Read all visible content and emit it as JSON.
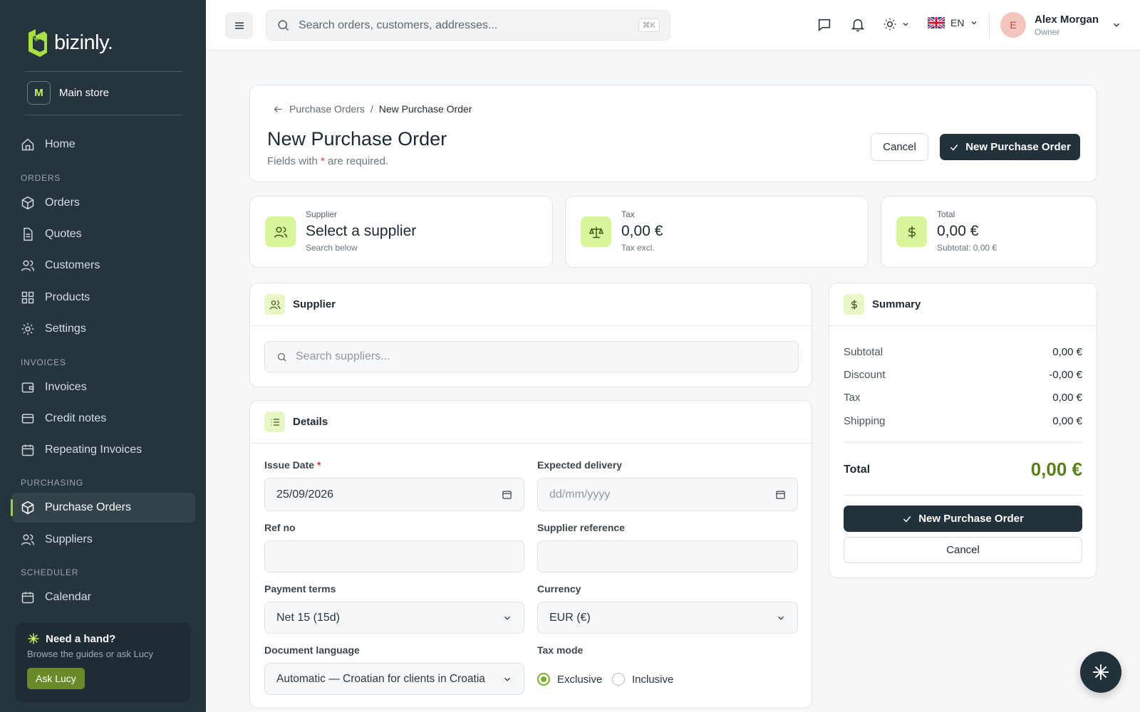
{
  "app": {
    "name": "bizinly."
  },
  "store": {
    "badge": "M",
    "name": "Main store"
  },
  "sidebar": {
    "home": "Home",
    "sections": {
      "orders": "ORDERS",
      "invoices": "INVOICES",
      "purchasing": "PURCHASING",
      "scheduler": "SCHEDULER"
    },
    "items": {
      "orders": "Orders",
      "quotes": "Quotes",
      "customers": "Customers",
      "products": "Products",
      "settings": "Settings",
      "invoices": "Invoices",
      "credit_notes": "Credit notes",
      "repeating_invoices": "Repeating Invoices",
      "purchase_orders": "Purchase Orders",
      "suppliers": "Suppliers",
      "calendar": "Calendar"
    },
    "help": {
      "title": "Need a hand?",
      "subtitle": "Browse the guides or ask Lucy",
      "button": "Ask Lucy"
    }
  },
  "topbar": {
    "search_placeholder": "Search orders, customers, addresses...",
    "shortcut": "⌘K",
    "language": "EN",
    "user": {
      "initial": "E",
      "name": "Alex Morgan",
      "role": "Owner"
    }
  },
  "page": {
    "breadcrumb": {
      "parent": "Purchase Orders",
      "separator": "/",
      "current": "New Purchase Order"
    },
    "title": "New Purchase Order",
    "required_note": {
      "prefix": "Fields with",
      "star": "*",
      "suffix": "are required."
    },
    "cancel": "Cancel",
    "submit": "New Purchase Order"
  },
  "stats": {
    "supplier": {
      "label": "Supplier",
      "value": "Select a supplier",
      "sub": "Search below"
    },
    "tax": {
      "label": "Tax",
      "value": "0,00 €",
      "sub": "Tax excl."
    },
    "total": {
      "label": "Total",
      "value": "0,00 €",
      "sub": "Subtotal: 0,00 €"
    }
  },
  "supplier_section": {
    "title": "Supplier",
    "search_placeholder": "Search suppliers..."
  },
  "details": {
    "title": "Details",
    "issue_date": {
      "label": "Issue Date",
      "star": "*",
      "value": "25/09/2026"
    },
    "expected_delivery": {
      "label": "Expected delivery",
      "placeholder": "dd/mm/yyyy"
    },
    "ref_no": {
      "label": "Ref no",
      "value": ""
    },
    "supplier_reference": {
      "label": "Supplier reference",
      "value": ""
    },
    "payment_terms": {
      "label": "Payment terms",
      "value": "Net 15 (15d)"
    },
    "currency": {
      "label": "Currency",
      "value": "EUR (€)"
    },
    "document_language": {
      "label": "Document language",
      "value": "Automatic — Croatian for clients in Croatia"
    },
    "tax_mode": {
      "label": "Tax mode",
      "options": [
        "Exclusive",
        "Inclusive"
      ],
      "selected": "Exclusive"
    }
  },
  "summary": {
    "title": "Summary",
    "rows": [
      {
        "label": "Subtotal",
        "value": "0,00 €"
      },
      {
        "label": "Discount",
        "value": "-0,00 €"
      },
      {
        "label": "Tax",
        "value": "0,00 €"
      },
      {
        "label": "Shipping",
        "value": "0,00 €"
      }
    ],
    "total_label": "Total",
    "total_value": "0,00 €",
    "total_color": "#5a7f1c",
    "submit": "New Purchase Order",
    "cancel": "Cancel"
  },
  "colors": {
    "sidebar_bg": "#26343d",
    "accent": "#c7f26b",
    "primary_button": "#22313a"
  }
}
